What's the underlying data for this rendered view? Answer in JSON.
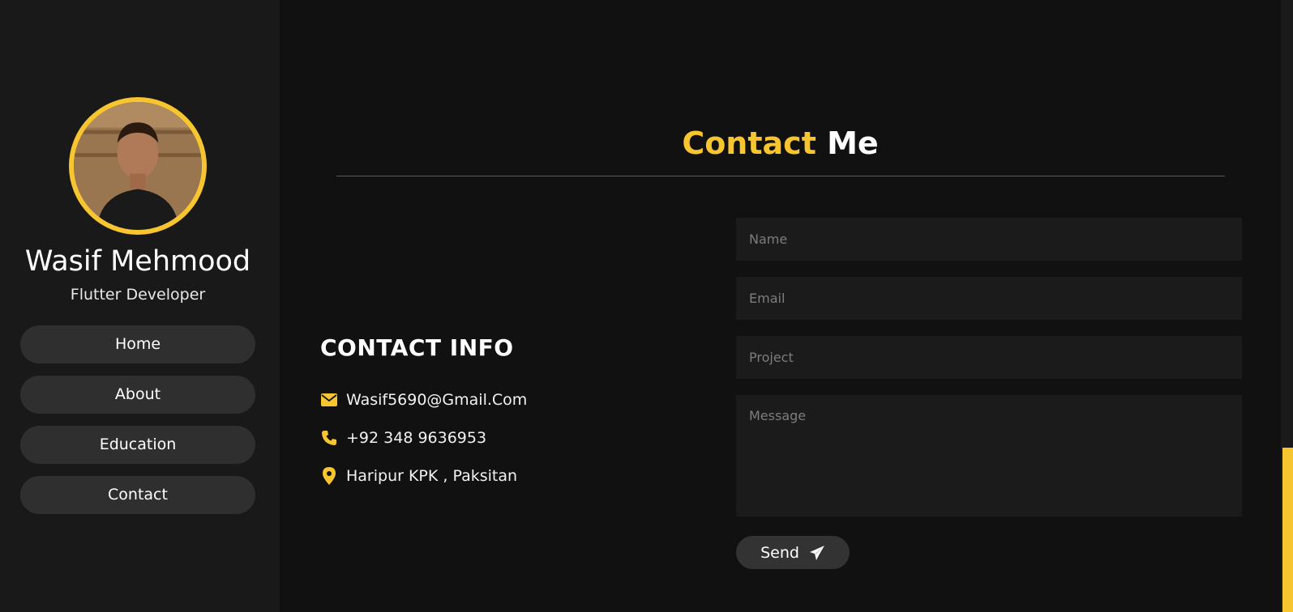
{
  "profile": {
    "name": "Wasif Mehmood",
    "role": "Flutter Developer"
  },
  "nav": {
    "items": [
      {
        "label": "Home"
      },
      {
        "label": "About"
      },
      {
        "label": "Education"
      },
      {
        "label": "Contact"
      }
    ]
  },
  "section": {
    "title_accent": "Contact",
    "title_rest": "Me"
  },
  "contact_info": {
    "heading": "CONTACT INFO",
    "email": {
      "icon": "envelope-icon",
      "text": "Wasif5690@Gmail.Com"
    },
    "phone": {
      "icon": "phone-icon",
      "text": "+92 348 9636953"
    },
    "location": {
      "icon": "map-pin-icon",
      "text": "Haripur KPK , Paksitan"
    }
  },
  "form": {
    "name_placeholder": "Name",
    "email_placeholder": "Email",
    "project_placeholder": "Project",
    "message_placeholder": "Message",
    "send_label": "Send",
    "send_icon": "paper-plane-icon"
  },
  "colors": {
    "accent": "#f7c52f",
    "background": "#111111",
    "sidebar": "#191919",
    "field": "#1b1b1b",
    "button": "#2f2f2f"
  }
}
